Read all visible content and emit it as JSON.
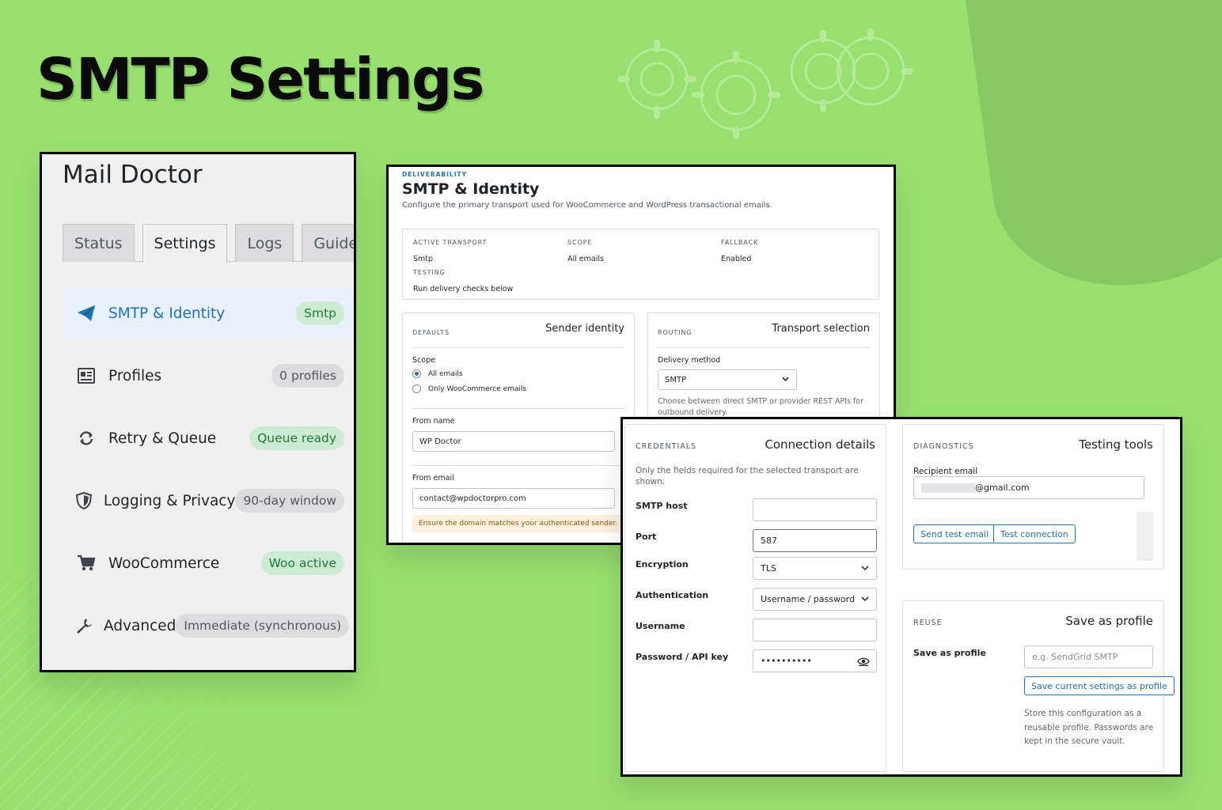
{
  "page": {
    "title": "SMTP Settings"
  },
  "sidebar": {
    "app_title": "Mail Doctor",
    "tabs": [
      {
        "label": "Status"
      },
      {
        "label": "Settings",
        "active": true
      },
      {
        "label": "Logs"
      },
      {
        "label": "Guides"
      }
    ],
    "items": [
      {
        "label": "SMTP & Identity",
        "badge": "Smtp",
        "icon": "paper-plane-icon",
        "active": true
      },
      {
        "label": "Profiles",
        "badge": "0 profiles",
        "icon": "id-card-icon"
      },
      {
        "label": "Retry & Queue",
        "badge": "Queue ready",
        "icon": "refresh-icon"
      },
      {
        "label": "Logging & Privacy",
        "badge": "90-day window",
        "icon": "shield-icon"
      },
      {
        "label": "WooCommerce",
        "badge": "Woo active",
        "icon": "cart-icon"
      },
      {
        "label": "Advanced",
        "badge": "Immediate (synchronous)",
        "icon": "wrench-icon"
      }
    ]
  },
  "identity": {
    "overline": "DELIVERABILITY",
    "title": "SMTP & Identity",
    "description": "Configure the primary transport used for WooCommerce and WordPress transactional emails.",
    "summary": {
      "active_transport": {
        "label": "ACTIVE TRANSPORT",
        "value": "Smtp"
      },
      "scope": {
        "label": "SCOPE",
        "value": "All emails"
      },
      "fallback": {
        "label": "FALLBACK",
        "value": "Enabled"
      },
      "testing": {
        "label": "TESTING",
        "value": "Run delivery checks below"
      }
    },
    "defaults": {
      "cap": "DEFAULTS",
      "heading": "Sender identity",
      "scope_label": "Scope",
      "scope_options": [
        "All emails",
        "Only WooCommerce emails"
      ],
      "from_name_label": "From name",
      "from_name_value": "WP Doctor",
      "from_email_label": "From email",
      "from_email_value": "contact@wpdoctorpro.com",
      "notice": "Ensure the domain matches your authenticated sender."
    },
    "routing": {
      "cap": "ROUTING",
      "heading": "Transport selection",
      "method_label": "Delivery method",
      "method_value": "SMTP",
      "help": "Choose between direct SMTP or provider REST APIs for outbound delivery."
    }
  },
  "credentials": {
    "cap": "CREDENTIALS",
    "heading": "Connection details",
    "description": "Only the fields required for the selected transport are shown.",
    "host_label": "SMTP host",
    "host_value": "",
    "port_label": "Port",
    "port_value": "587",
    "encryption_label": "Encryption",
    "encryption_value": "TLS",
    "auth_label": "Authentication",
    "auth_value": "Username / password",
    "username_label": "Username",
    "username_value": "",
    "password_label": "Password / API key",
    "password_value": "••••••••••"
  },
  "diagnostics": {
    "cap": "DIAGNOSTICS",
    "heading": "Testing tools",
    "recipient_label": "Recipient email",
    "recipient_suffix": "@gmail.com",
    "send_button": "Send test email",
    "test_button": "Test connection"
  },
  "reuse": {
    "cap": "REUSE",
    "heading": "Save as profile",
    "label": "Save as profile",
    "placeholder": "e.g. SendGrid SMTP",
    "save_button": "Save current settings as profile",
    "help": "Store this configuration as a reusable profile. Passwords are kept in the secure vault."
  },
  "colors": {
    "background": "#97e06f",
    "accent": "#2271b1",
    "badge_green": "#cdebd3"
  }
}
